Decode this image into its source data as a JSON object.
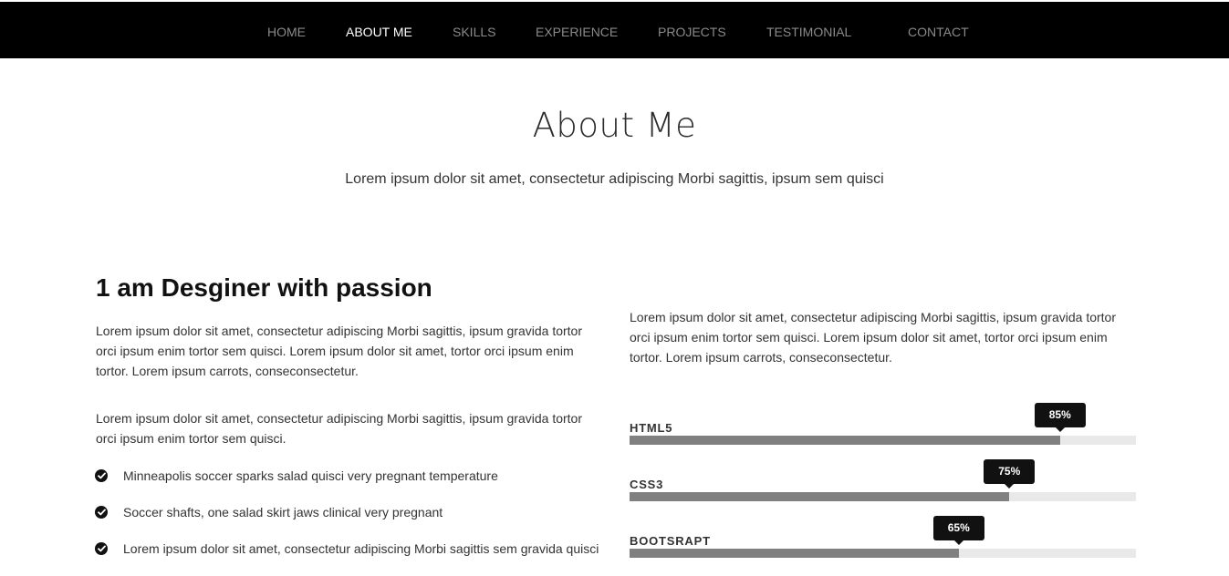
{
  "nav": {
    "items": [
      {
        "label": "HOME"
      },
      {
        "label": "ABOUT ME"
      },
      {
        "label": "SKILLS"
      },
      {
        "label": "EXPERIENCE"
      },
      {
        "label": "PROJECTS"
      },
      {
        "label": "TESTIMONIAL"
      },
      {
        "label": "CONTACT"
      }
    ],
    "active": "ABOUT ME"
  },
  "about": {
    "title": "About Me",
    "subtitle": "Lorem ipsum dolor sit amet, consectetur adipiscing Morbi sagittis, ipsum sem quisci",
    "heading": "1 am Desginer with passion",
    "left_para_1": "Lorem ipsum dolor sit amet, consectetur adipiscing Morbi sagittis, ipsum gravida tortor orci ipsum enim tortor sem quisci. Lorem ipsum dolor sit amet, tortor orci ipsum enim tortor. Lorem ipsum carrots, conseconsectetur.",
    "left_para_2": "Lorem ipsum dolor sit amet, consectetur adipiscing Morbi sagittis, ipsum gravida tortor orci ipsum enim tortor sem quisci.",
    "checklist": [
      "Minneapolis soccer sparks salad quisci very pregnant temperature",
      "Soccer shafts, one salad skirt jaws clinical very pregnant",
      "Lorem ipsum dolor sit amet, consectetur adipiscing Morbi sagittis sem gravida quisci"
    ],
    "right_para": "Lorem ipsum dolor sit amet, consectetur adipiscing Morbi sagittis, ipsum gravida tortor orci ipsum enim tortor sem quisci. Lorem ipsum dolor sit amet, tortor orci ipsum enim tortor. Lorem ipsum carrots, conseconsectetur."
  },
  "skills": [
    {
      "name": "HTML5",
      "percent": 85,
      "label": "85%"
    },
    {
      "name": "CSS3",
      "percent": 75,
      "label": "75%"
    },
    {
      "name": "BOOTSRAPT",
      "percent": 65,
      "label": "65%"
    }
  ],
  "colors": {
    "nav_bg": "#000000",
    "nav_text": "#8a8a8a",
    "nav_active": "#ffffff",
    "bar_fill": "#808080",
    "bar_track": "#e9e9e9",
    "tooltip_bg": "#111111"
  },
  "icons": {
    "checklist": "check-circle-icon"
  }
}
